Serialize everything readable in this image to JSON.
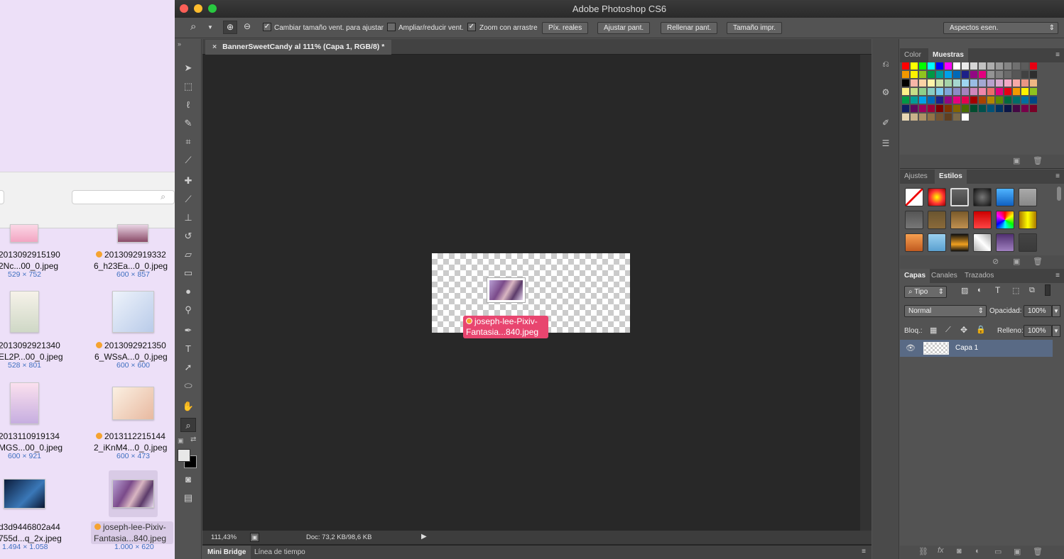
{
  "finder": {
    "items": [
      {
        "name1": "2013092915190",
        "name2": "2Nc...00_0.jpeg",
        "dims": "529 × 752",
        "dot": false
      },
      {
        "name1": "2013092919332",
        "name2": "6_h23Ea...0_0.jpeg",
        "dims": "600 × 857",
        "dot": true
      },
      {
        "name1": "2013092921340",
        "name2": "EL2P...00_0.jpeg",
        "dims": "528 × 801",
        "dot": false
      },
      {
        "name1": "2013092921350",
        "name2": "6_WSsA...0_0.jpeg",
        "dims": "600 × 600",
        "dot": true
      },
      {
        "name1": "2013110919134",
        "name2": "MGS...00_0.jpeg",
        "dims": "600 × 921",
        "dot": false
      },
      {
        "name1": "2013112215144",
        "name2": "2_iKnM4...0_0.jpeg",
        "dims": "600 × 473",
        "dot": true
      },
      {
        "name1": "d3d9446802a44",
        "name2": "755d...q_2x.jpeg",
        "dims": "1.494 × 1.058",
        "dot": false
      },
      {
        "name1": "joseph-lee-Pixiv-",
        "name2": "Fantasia...840.jpeg",
        "dims": "1.000 × 620",
        "dot": true
      }
    ]
  },
  "app": {
    "title": "Adobe Photoshop CS6"
  },
  "options": {
    "resize_label": "Cambiar tamaño vent. para ajustar",
    "zoom_all_label": "Ampliar/reducir vent.",
    "scrubby_label": "Zoom con arrastre",
    "btn_actual": "Píx. reales",
    "btn_fit": "Ajustar pant.",
    "btn_fill": "Rellenar pant.",
    "btn_print": "Tamaño impr.",
    "workspace": "Aspectos esen.",
    "resize_checked": true,
    "zoom_all_checked": false,
    "scrubby_checked": true
  },
  "document": {
    "tab_title": "BannerSweetCandy al 111% (Capa 1, RGB/8) *",
    "zoom": "111,43%",
    "doc_info": "Doc: 73,2 KB/98,6 KB",
    "drag_label1": "joseph-lee-Pixiv-",
    "drag_label2": "Fantasia...840.jpeg"
  },
  "bottom_tabs": {
    "mini_bridge": "Mini Bridge",
    "timeline": "Línea de tiempo"
  },
  "panels": {
    "color_tab": "Color",
    "swatches_tab": "Muestras",
    "adjust_tab": "Ajustes",
    "styles_tab": "Estilos",
    "layers_tab": "Capas",
    "channels_tab": "Canales",
    "paths_tab": "Trazados",
    "filter_kind": "Tipo",
    "blend_mode": "Normal",
    "opacity_label": "Opacidad:",
    "opacity_value": "100%",
    "lock_label": "Bloq.:",
    "fill_label": "Relleno:",
    "fill_value": "100%",
    "layer_name": "Capa 1"
  },
  "colors": {
    "accent_drag": "#e8456f",
    "layer_selected": "#596a85"
  }
}
